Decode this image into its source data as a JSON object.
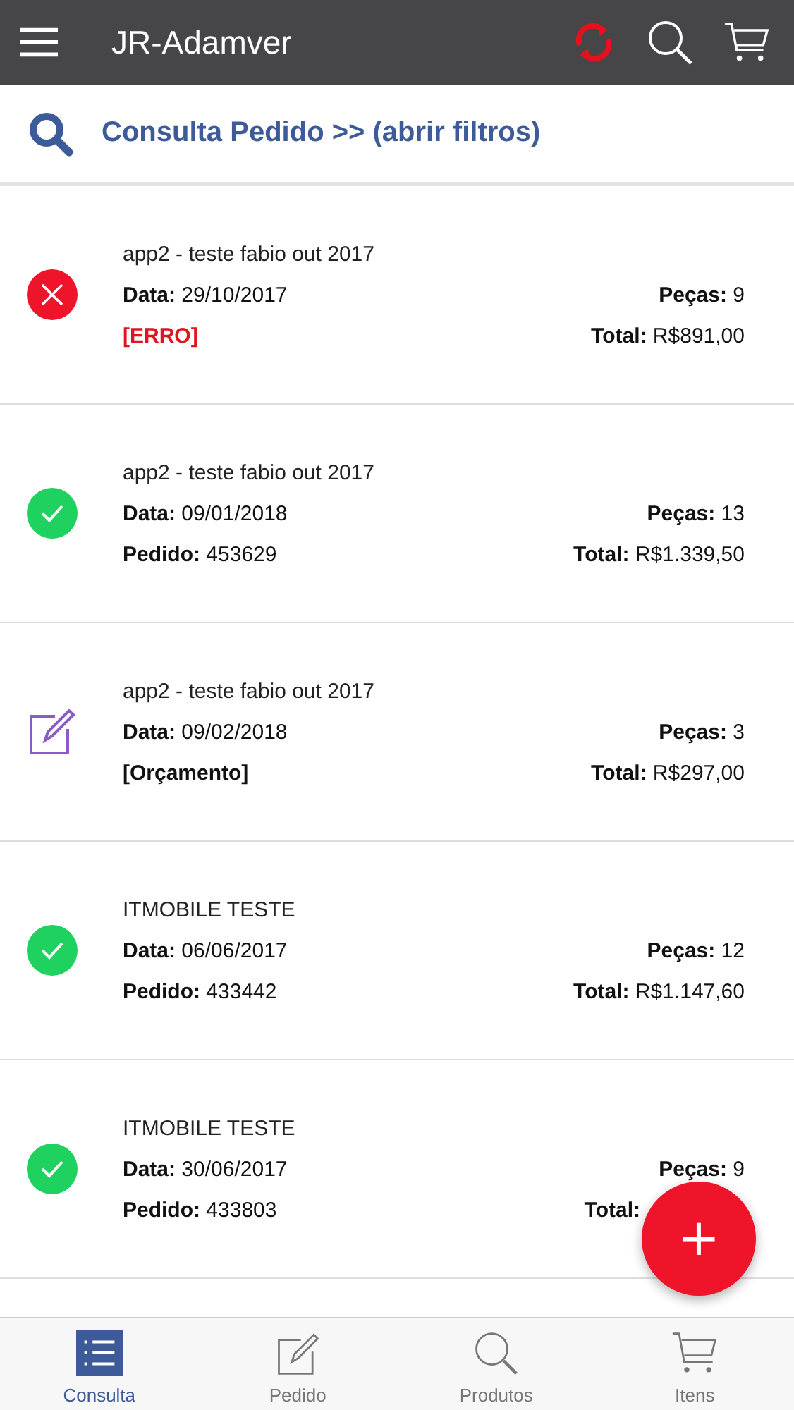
{
  "app_bar": {
    "title": "JR-Adamver"
  },
  "query_header": {
    "title": "Consulta Pedido >> (abrir filtros)"
  },
  "orders": [
    {
      "kind": "error",
      "name": "app2 - teste fabio out 2017",
      "date_label": "Data:",
      "date": "29/10/2017",
      "pieces_label": "Peças:",
      "pieces": "9",
      "tag": "[ERRO]",
      "total_label": "Total:",
      "total": "R$891,00"
    },
    {
      "kind": "done",
      "name": "app2 - teste fabio out 2017",
      "date_label": "Data:",
      "date": "09/01/2018",
      "pieces_label": "Peças:",
      "pieces": "13",
      "order_label": "Pedido:",
      "order": "453629",
      "total_label": "Total:",
      "total": "R$1.339,50"
    },
    {
      "kind": "draft",
      "name": "app2 - teste fabio out 2017",
      "date_label": "Data:",
      "date": "09/02/2018",
      "pieces_label": "Peças:",
      "pieces": "3",
      "tag": "[Orçamento]",
      "total_label": "Total:",
      "total": "R$297,00"
    },
    {
      "kind": "done",
      "name": "ITMOBILE TESTE",
      "date_label": "Data:",
      "date": "06/06/2017",
      "pieces_label": "Peças:",
      "pieces": "12",
      "order_label": "Pedido:",
      "order": "433442",
      "total_label": "Total:",
      "total": "R$1.147,60"
    },
    {
      "kind": "done",
      "name": "ITMOBILE TESTE",
      "date_label": "Data:",
      "date": "30/06/2017",
      "pieces_label": "Peças:",
      "pieces": "9",
      "order_label": "Pedido:",
      "order": "433803",
      "total_label": "Total:"
    }
  ],
  "fab": {
    "label": "+"
  },
  "tabs": [
    {
      "kind": "list",
      "label": "Consulta",
      "selected": true
    },
    {
      "kind": "edit",
      "label": "Pedido",
      "selected": false
    },
    {
      "kind": "search",
      "label": "Produtos",
      "selected": false
    },
    {
      "kind": "cart",
      "label": "Itens",
      "selected": false
    }
  ]
}
